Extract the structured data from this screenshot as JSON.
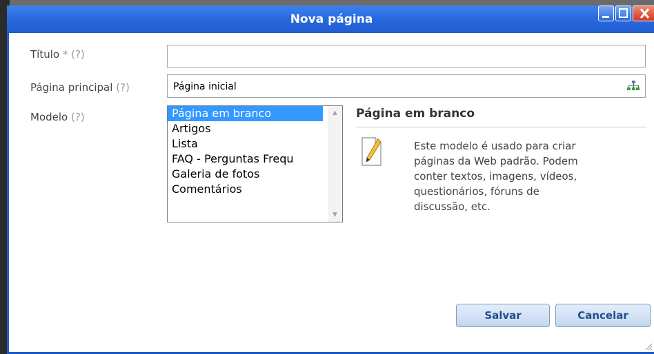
{
  "window": {
    "title": "Nova página",
    "controls": {
      "minimize": "minimize-icon",
      "maximize": "maximize-icon",
      "close": "close-icon"
    }
  },
  "form": {
    "titulo": {
      "label": "Título",
      "required_mark": "*",
      "help": "(?)",
      "value": ""
    },
    "pagina_principal": {
      "label": "Página principal",
      "help": "(?)",
      "value": "Página inicial",
      "icon": "sitemap-icon"
    },
    "modelo": {
      "label": "Modelo",
      "help": "(?)",
      "options": [
        "Página em branco",
        "Artigos",
        "Lista",
        "FAQ - Perguntas Frequ",
        "Galeria de fotos",
        "Comentários"
      ],
      "selected_index": 0
    }
  },
  "description": {
    "title": "Página em branco",
    "icon": "pencil-document-icon",
    "lines": [
      "Este modelo é usado para criar",
      "páginas da Web padrão. Podem",
      "conter textos, imagens, vídeos,",
      "questionários, fóruns de",
      "discussão, etc."
    ]
  },
  "buttons": {
    "save": "Salvar",
    "cancel": "Cancelar"
  },
  "colors": {
    "titlebar": "#2a6ae0",
    "selection": "#3399ff",
    "button_text": "#1f4f8a"
  }
}
